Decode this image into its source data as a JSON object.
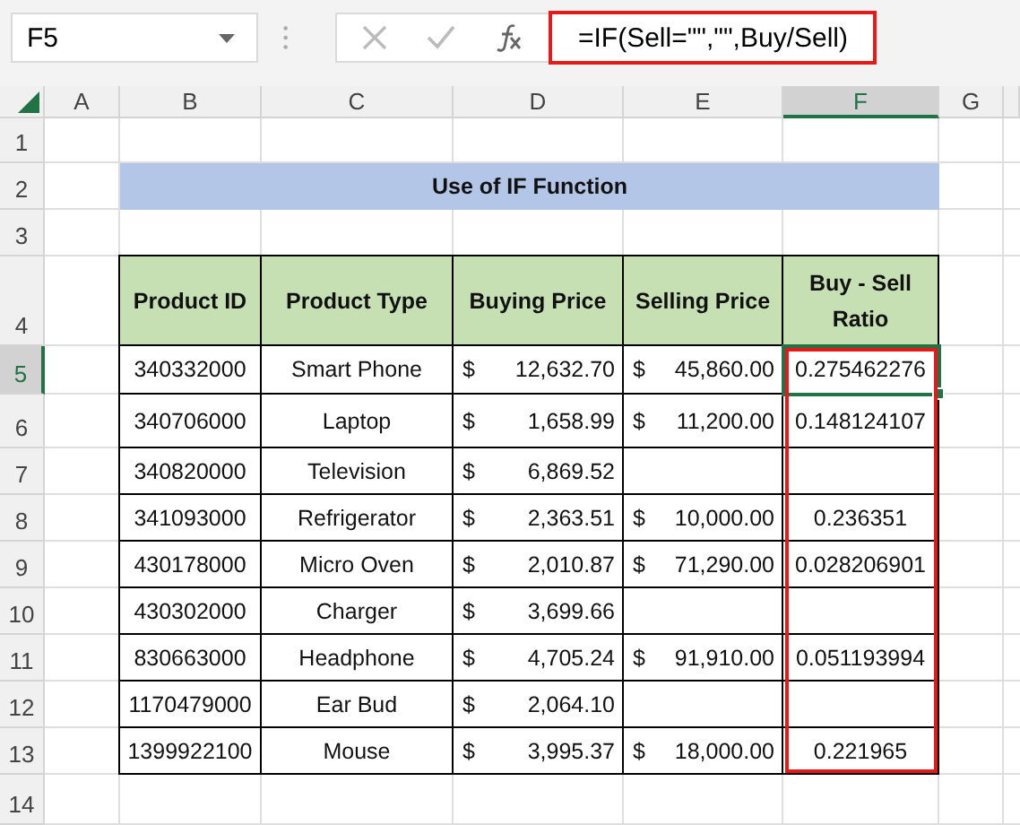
{
  "formula_bar": {
    "name_box": "F5",
    "formula": "=IF(Sell=\"\",\"\",Buy/Sell)",
    "highlighted": true
  },
  "columns": [
    {
      "label": "A",
      "selected": false
    },
    {
      "label": "B",
      "selected": false
    },
    {
      "label": "C",
      "selected": false
    },
    {
      "label": "D",
      "selected": false
    },
    {
      "label": "E",
      "selected": false
    },
    {
      "label": "F",
      "selected": true
    },
    {
      "label": "G",
      "selected": false
    }
  ],
  "row_numbers": [
    {
      "label": "1",
      "selected": false
    },
    {
      "label": "2",
      "selected": false
    },
    {
      "label": "3",
      "selected": false
    },
    {
      "label": "4",
      "selected": false
    },
    {
      "label": "5",
      "selected": true
    },
    {
      "label": "6",
      "selected": false
    },
    {
      "label": "7",
      "selected": false
    },
    {
      "label": "8",
      "selected": false
    },
    {
      "label": "9",
      "selected": false
    },
    {
      "label": "10",
      "selected": false
    },
    {
      "label": "11",
      "selected": false
    },
    {
      "label": "12",
      "selected": false
    },
    {
      "label": "13",
      "selected": false
    },
    {
      "label": "14",
      "selected": false
    }
  ],
  "title": "Use of IF Function",
  "table": {
    "headers": [
      "Product ID",
      "Product Type",
      "Buying Price",
      "Selling Price",
      "Buy - Sell Ratio"
    ],
    "ratio_column_highlighted": true,
    "rows": [
      {
        "id": "340332000",
        "type": "Smart Phone",
        "buying": {
          "currency": "$",
          "amount": "12,632.70"
        },
        "selling": {
          "currency": "$",
          "amount": "45,860.00"
        },
        "ratio": "0.275462276",
        "selected": true
      },
      {
        "id": "340706000",
        "type": "Laptop",
        "buying": {
          "currency": "$",
          "amount": "1,658.99"
        },
        "selling": {
          "currency": "$",
          "amount": "11,200.00"
        },
        "ratio": "0.148124107",
        "selected": false
      },
      {
        "id": "340820000",
        "type": "Television",
        "buying": {
          "currency": "$",
          "amount": "6,869.52"
        },
        "selected": false
      },
      {
        "id": "341093000",
        "type": "Refrigerator",
        "buying": {
          "currency": "$",
          "amount": "2,363.51"
        },
        "selling": {
          "currency": "$",
          "amount": "10,000.00"
        },
        "ratio": "0.236351",
        "selected": false
      },
      {
        "id": "430178000",
        "type": "Micro Oven",
        "buying": {
          "currency": "$",
          "amount": "2,010.87"
        },
        "selling": {
          "currency": "$",
          "amount": "71,290.00"
        },
        "ratio": "0.028206901",
        "selected": false
      },
      {
        "id": "430302000",
        "type": "Charger",
        "buying": {
          "currency": "$",
          "amount": "3,699.66"
        },
        "selected": false
      },
      {
        "id": "830663000",
        "type": "Headphone",
        "buying": {
          "currency": "$",
          "amount": "4,705.24"
        },
        "selling": {
          "currency": "$",
          "amount": "91,910.00"
        },
        "ratio": "0.051193994",
        "selected": false
      },
      {
        "id": "1170479000",
        "type": "Ear Bud",
        "buying": {
          "currency": "$",
          "amount": "2,064.10"
        },
        "selected": false
      },
      {
        "id": "1399922100",
        "type": "Mouse",
        "buying": {
          "currency": "$",
          "amount": "3,995.37"
        },
        "selling": {
          "currency": "$",
          "amount": "18,000.00"
        },
        "ratio": "0.221965",
        "selected": false
      }
    ]
  }
}
